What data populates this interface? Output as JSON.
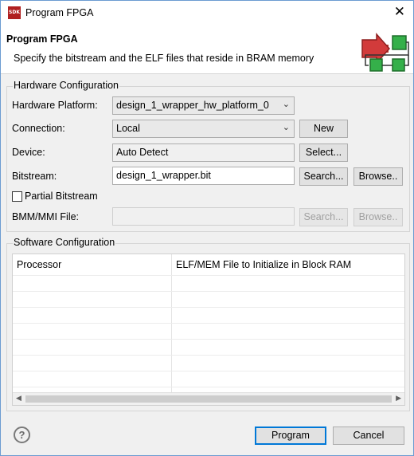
{
  "titlebar": {
    "icon_text": "SDK",
    "title": "Program FPGA",
    "close_glyph": "✕"
  },
  "banner": {
    "title": "Program FPGA",
    "description": "Specify the bitstream and the ELF files that reside in BRAM memory",
    "icon": "program-fpga-flow-icon"
  },
  "hardware": {
    "legend": "Hardware Configuration",
    "platform_label": "Hardware Platform:",
    "platform_value": "design_1_wrapper_hw_platform_0",
    "connection_label": "Connection:",
    "connection_value": "Local",
    "new_button": "New",
    "device_label": "Device:",
    "device_value": "Auto Detect",
    "select_button": "Select...",
    "bitstream_label": "Bitstream:",
    "bitstream_value": "design_1_wrapper.bit",
    "search_button": "Search...",
    "browse_button": "Browse..",
    "partial_label": "Partial Bitstream",
    "partial_checked": false,
    "bmm_label": "BMM/MMI File:",
    "bmm_value": "",
    "bmm_search_button": "Search...",
    "bmm_browse_button": "Browse.."
  },
  "software": {
    "legend": "Software Configuration",
    "columns": [
      "Processor",
      "ELF/MEM File to Initialize in Block RAM"
    ],
    "rows": []
  },
  "footer": {
    "help_glyph": "?",
    "program_button": "Program",
    "cancel_button": "Cancel"
  },
  "colors": {
    "accent": "#0078d7",
    "arrow_red": "#c0392b",
    "block_green": "#2e9e3e"
  }
}
